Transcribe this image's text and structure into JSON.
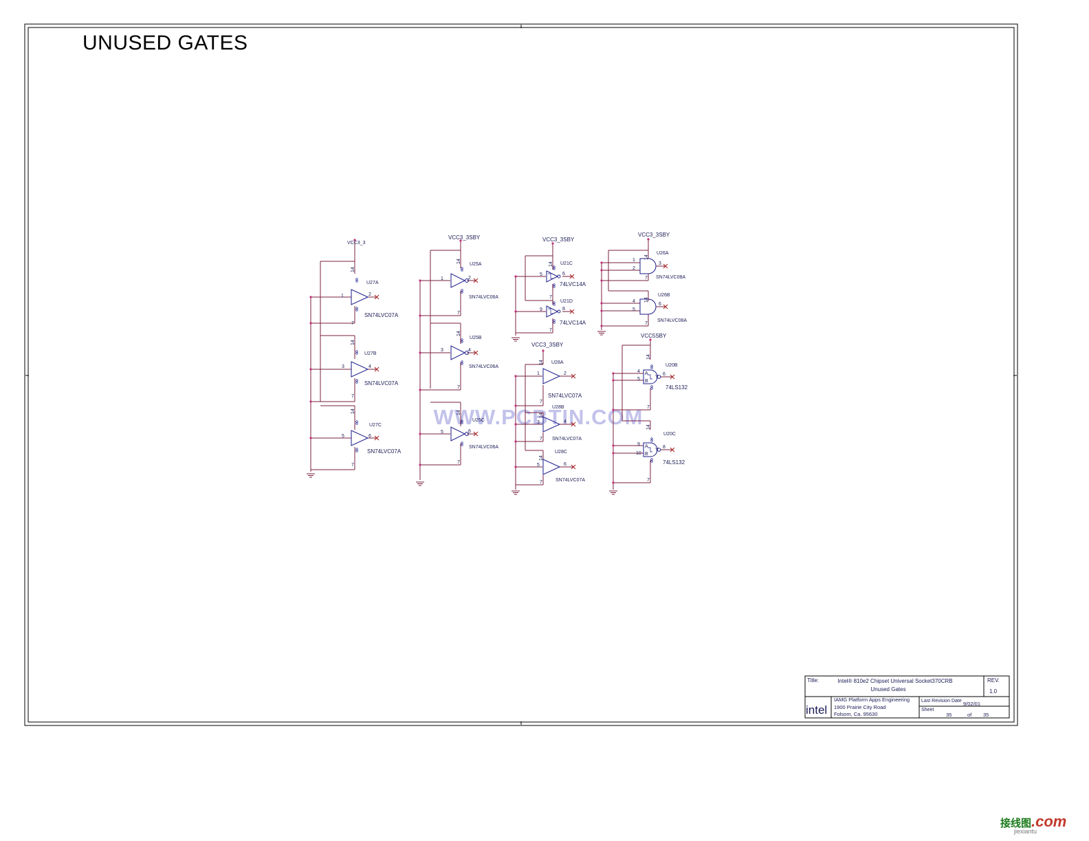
{
  "heading": "UNUSED GATES",
  "watermark_center": "WWW.PCBTIN.COM",
  "watermark_corner": {
    "cn": "接线图",
    "com": ".com",
    "sub": "jiexiantu"
  },
  "colors": {
    "wire": "#7a1f3d",
    "symbol": "#1a1a8a",
    "text": "#1a1a55",
    "dot": "#c0307a",
    "noconn": "#b03030",
    "watermark": "#b8b8e8"
  },
  "title_block": {
    "title_label": "Title:",
    "title_line1": "Intel® 810e2 Chipset Universal Socket370CRB",
    "title_line2": "Unused Gates",
    "rev_label": "REV.",
    "rev_value": "1.0",
    "logo": "intel",
    "org_line1": "IAMG Platform Apps Engineering",
    "org_line2": "1900 Prairie City Road",
    "org_line3": "Folsom, Ca. 95630",
    "last_rev_label": "Last Revision Date",
    "last_rev_value": "9/02/01",
    "sheet_label": "Sheet",
    "sheet_num": "35",
    "of_label": "of",
    "sheet_total": "35"
  },
  "nets": {
    "col1": "VCC3_3",
    "col2": "VCC3_3SBY",
    "col3": "VCC3_3SBY",
    "col3b": "VCC3_3SBY",
    "col4": "VCC3_3SBY",
    "col4b": "VCC5SBY"
  },
  "gates": {
    "u27a": {
      "ref": "U27A",
      "part": "SN74LVC07A",
      "in": "1",
      "out": "2",
      "vcc": "14",
      "gnd": "7"
    },
    "u27b": {
      "ref": "U27B",
      "part": "SN74LVC07A",
      "in": "3",
      "out": "4",
      "vcc": "14",
      "gnd": "7"
    },
    "u27c": {
      "ref": "U27C",
      "part": "SN74LVC07A",
      "in": "5",
      "out": "6",
      "vcc": "14",
      "gnd": "7"
    },
    "u25a": {
      "ref": "U25A",
      "part": "SN74LVC06A",
      "in": "1",
      "out": "2",
      "vcc": "14",
      "gnd": "7"
    },
    "u25b": {
      "ref": "U25B",
      "part": "SN74LVC06A",
      "in": "3",
      "out": "4",
      "vcc": "14",
      "gnd": "7"
    },
    "u25c": {
      "ref": "U25C",
      "part": "SN74LVC06A",
      "in": "5",
      "out": "6",
      "vcc": "14",
      "gnd": "7"
    },
    "u21c": {
      "ref": "U21C",
      "part": "74LVC14A",
      "in": "5",
      "out": "6",
      "vcc": "14",
      "gnd": "7"
    },
    "u21d": {
      "ref": "U21D",
      "part": "74LVC14A",
      "in": "9",
      "out": "8",
      "vcc": "14",
      "gnd": "7"
    },
    "u28a": {
      "ref": "U28A",
      "part": "SN74LVC07A",
      "in": "1",
      "out": "2",
      "vcc": "14",
      "gnd": "7"
    },
    "u28b": {
      "ref": "U28B",
      "part": "SN74LVC07A",
      "in": "3",
      "out": "4",
      "vcc": "14",
      "gnd": "7"
    },
    "u28c": {
      "ref": "U28C",
      "part": "SN74LVC07A",
      "in": "5",
      "out": "6",
      "vcc": "14",
      "gnd": "7"
    },
    "u26a": {
      "ref": "U26A",
      "part": "SN74LVC08A",
      "in1": "1",
      "in2": "2",
      "out": "3",
      "vcc": "14",
      "gnd": "7"
    },
    "u26b": {
      "ref": "U26B",
      "part": "SN74LVC08A",
      "in1": "4",
      "in2": "5",
      "out": "6",
      "vcc": "14",
      "gnd": "7"
    },
    "u20b": {
      "ref": "U20B",
      "part": "74LS132",
      "in1": "4",
      "in2": "5",
      "out": "6",
      "vcc": "14",
      "gnd": "7",
      "pin_a": "A",
      "pin_b": "B",
      "pin_y": "Y"
    },
    "u20c": {
      "ref": "U20C",
      "part": "74LS132",
      "in1": "9",
      "in2": "10",
      "out": "8",
      "vcc": "14",
      "gnd": "7",
      "pin_a": "A",
      "pin_b": "B",
      "pin_y": "Y"
    }
  }
}
